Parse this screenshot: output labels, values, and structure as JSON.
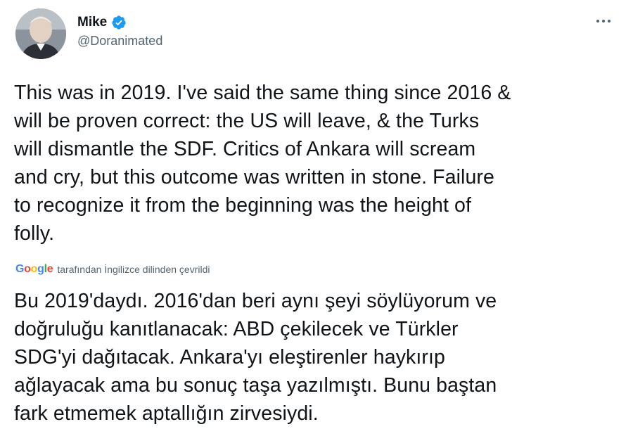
{
  "user": {
    "display_name": "Mike",
    "handle": "@Doranimated",
    "verified": true,
    "avatar_icon": "avatar-photo"
  },
  "more_icon": "ellipsis-icon",
  "tweet": {
    "original_lines": [
      "This was in 2019. I've said the same thing since 2016 &",
      "will be proven correct: the US will leave, & the Turks",
      "will dismantle the SDF. Critics of Ankara will scream",
      "and cry, but this outcome was written in stone. Failure",
      "to recognize it from the beginning was the height of",
      "folly."
    ],
    "translated_by_prefix": "Google",
    "translated_by_text": "tarafından İngilizce dilinden çevrildi",
    "translated_lines": [
      "Bu 2019'daydı. 2016'dan beri aynı şeyi söylüyorum ve",
      "doğruluğu kanıtlanacak: ABD çekilecek ve Türkler",
      "SDG'yi dağıtacak. Ankara'yı eleştirenler haykırıp",
      "ağlayacak ama bu sonuç taşa yazılmıştı. Bunu baştan",
      "fark etmemek aptallığın zirvesiydi."
    ]
  },
  "colors": {
    "text": "#0f1419",
    "secondary": "#536471",
    "verified_blue": "#1d9bf0",
    "google_blue": "#4285f4",
    "google_red": "#ea4335",
    "google_yellow": "#fbbc05",
    "google_green": "#34a853"
  }
}
